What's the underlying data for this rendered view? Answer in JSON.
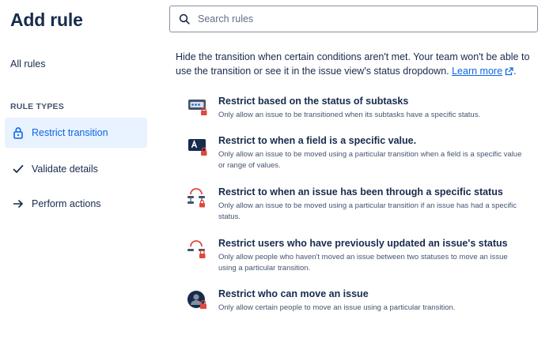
{
  "page": {
    "title": "Add rule"
  },
  "sidebar": {
    "all_rules": "All rules",
    "section_label": "RULE TYPES",
    "items": [
      {
        "label": "Restrict transition",
        "icon": "lock-icon",
        "active": true
      },
      {
        "label": "Validate details",
        "icon": "check-icon",
        "active": false
      },
      {
        "label": "Perform actions",
        "icon": "arrow-right-icon",
        "active": false
      }
    ]
  },
  "search": {
    "placeholder": "Search rules",
    "value": ""
  },
  "intro": {
    "text": "Hide the transition when certain conditions aren't met. Your team won't be able to use the transition or see it in the issue view's status dropdown.",
    "link": "Learn more",
    "after": "."
  },
  "rules": [
    {
      "title": "Restrict based on the status of subtasks",
      "description": "Only allow an issue to be transitioned when its subtasks have a specific status.",
      "icon": "subtasks-lock-icon"
    },
    {
      "title": "Restrict to when a field is a specific value.",
      "description": "Only allow an issue to be moved using a particular transition when a field is a specific value or range of values.",
      "icon": "field-lock-icon"
    },
    {
      "title": "Restrict to when an issue has been through a specific status",
      "description": "Only allow an issue to be moved using a particular transition if an issue has had a specific status.",
      "icon": "status-history-lock-icon"
    },
    {
      "title": "Restrict users who have previously updated an issue's status",
      "description": "Only allow people who haven't moved an issue between two statuses to move an issue using a particular transition.",
      "icon": "previous-users-lock-icon"
    },
    {
      "title": "Restrict who can move an issue",
      "description": "Only allow certain people to move an issue using a particular transition.",
      "icon": "user-lock-icon"
    }
  ],
  "colors": {
    "accent": "#0c66e4",
    "active_bg": "#e9f2ff",
    "text": "#172b4d",
    "subtle": "#44546f",
    "lock_red": "#e2483d"
  }
}
